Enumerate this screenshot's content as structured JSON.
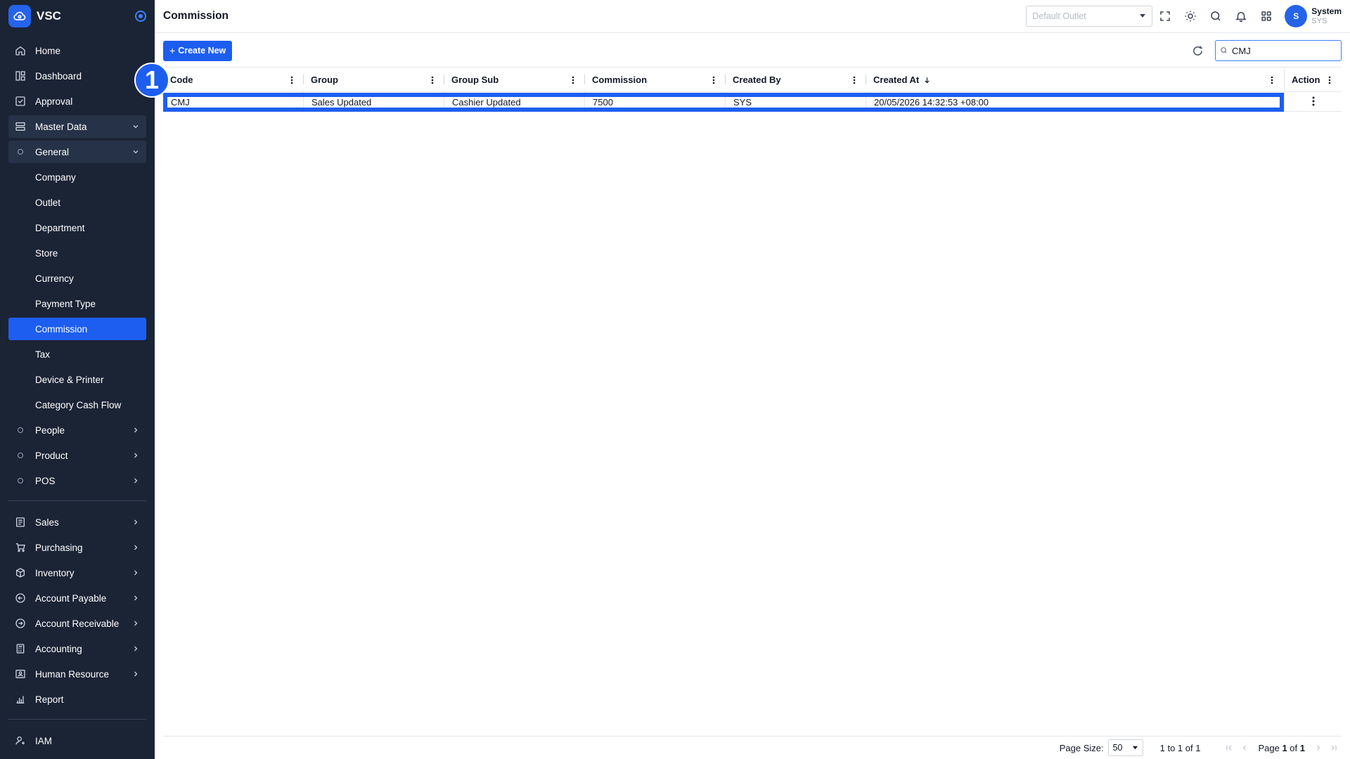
{
  "app": {
    "name": "VSC"
  },
  "sidebar": {
    "top_items": [
      {
        "label": "Home",
        "icon": "home-icon"
      },
      {
        "label": "Dashboard",
        "icon": "dashboard-icon"
      },
      {
        "label": "Approval",
        "icon": "approval-icon"
      }
    ],
    "master_data": {
      "label": "Master Data",
      "icon": "master-data-icon"
    },
    "general": {
      "label": "General"
    },
    "general_items": [
      "Company",
      "Outlet",
      "Department",
      "Store",
      "Currency",
      "Payment Type",
      "Commission",
      "Tax",
      "Device & Printer",
      "Category Cash Flow"
    ],
    "active_item": "Commission",
    "collapsed_groups": [
      "People",
      "Product",
      "POS"
    ],
    "modules": [
      {
        "label": "Sales",
        "icon": "sales-icon"
      },
      {
        "label": "Purchasing",
        "icon": "cart-icon"
      },
      {
        "label": "Inventory",
        "icon": "box-icon"
      },
      {
        "label": "Account Payable",
        "icon": "arrow-left-circle-icon"
      },
      {
        "label": "Account Receivable",
        "icon": "arrow-right-circle-icon"
      },
      {
        "label": "Accounting",
        "icon": "calculator-icon"
      },
      {
        "label": "Human Resource",
        "icon": "id-card-icon"
      },
      {
        "label": "Report",
        "icon": "bar-chart-icon"
      }
    ],
    "iam": {
      "label": "IAM",
      "icon": "user-key-icon"
    }
  },
  "header": {
    "title": "Commission",
    "outlet_placeholder": "Default Outlet",
    "user": {
      "initial": "S",
      "name": "System",
      "code": "SYS"
    }
  },
  "toolbar": {
    "create_label": "Create New",
    "search_value": "CMJ"
  },
  "table": {
    "columns": [
      "Code",
      "Group",
      "Group Sub",
      "Commission",
      "Created By",
      "Created At",
      "Action"
    ],
    "rows": [
      {
        "code": "CMJ",
        "group": "Sales Updated",
        "group_sub": "Cashier Updated",
        "commission": "7500",
        "created_by": "SYS",
        "created_at": "20/05/2026 14:32:53 +08:00"
      }
    ]
  },
  "step_badge": "1",
  "footer": {
    "page_size_label": "Page Size:",
    "page_size": "50",
    "range_text": "1 to 1 of 1",
    "page_word": "Page",
    "page_current": "1",
    "of_word": "of",
    "page_total": "1"
  },
  "colors": {
    "sidebar_bg": "#1b2435",
    "accent": "#1d5ef0"
  }
}
